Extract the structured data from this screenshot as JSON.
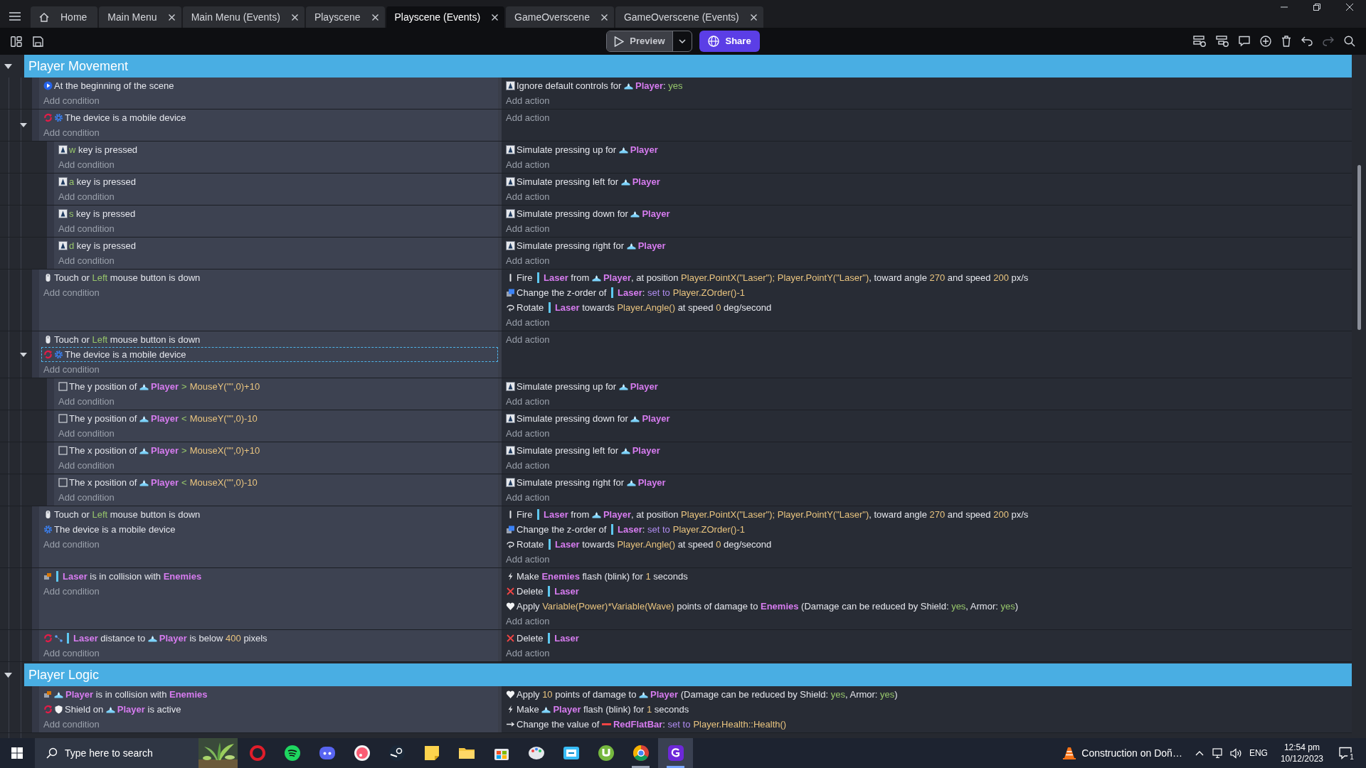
{
  "tabs": [
    {
      "label": "Home",
      "kind": "home",
      "selected": false
    },
    {
      "label": "Main Menu",
      "kind": "editor",
      "selected": false
    },
    {
      "label": "Main Menu (Events)",
      "kind": "editor",
      "selected": false
    },
    {
      "label": "Playscene",
      "kind": "editor",
      "selected": false
    },
    {
      "label": "Playscene (Events)",
      "kind": "editor",
      "selected": true
    },
    {
      "label": "GameOverscene",
      "kind": "editor",
      "selected": false
    },
    {
      "label": "GameOverscene (Events)",
      "kind": "editor",
      "selected": false
    }
  ],
  "toolbar": {
    "preview_label": "Preview",
    "share_label": "Share",
    "redo_disabled": true
  },
  "groups": [
    {
      "title": "Player Movement",
      "expanded": true,
      "events": [
        {
          "conditions": [
            {
              "kind": "scene_start",
              "inverted": false,
              "selected": false,
              "parts": [
                {
                  "text": "At the beginning of the scene"
                }
              ]
            }
          ],
          "add_condition": "Add condition",
          "actions": [
            {
              "kind": "keyboard",
              "parts": [
                {
                  "text": "Ignore default controls for "
                },
                {
                  "object": "Player",
                  "kind": "sprite"
                },
                {
                  "text": ": "
                },
                {
                  "keyword": "yes"
                }
              ]
            }
          ],
          "add_action": "Add action"
        },
        {
          "conditions": [
            {
              "kind": "mobile",
              "inverted": true,
              "selected": false,
              "parts": [
                {
                  "text": "The device is a mobile device"
                }
              ]
            }
          ],
          "add_condition": "Add condition",
          "add_action": "Add action",
          "expanded": true,
          "children": [
            {
              "conditions": [
                {
                  "kind": "key",
                  "inverted": false,
                  "selected": false,
                  "parts": [
                    {
                      "keyword": "w"
                    },
                    {
                      "text": " key is pressed"
                    }
                  ]
                }
              ],
              "add_condition": "Add condition",
              "actions": [
                {
                  "kind": "keyboard",
                  "parts": [
                    {
                      "text": "Simulate pressing up for "
                    },
                    {
                      "object": "Player",
                      "kind": "sprite"
                    }
                  ]
                }
              ],
              "add_action": "Add action"
            },
            {
              "conditions": [
                {
                  "kind": "key",
                  "inverted": false,
                  "selected": false,
                  "parts": [
                    {
                      "keyword": "a"
                    },
                    {
                      "text": " key is pressed"
                    }
                  ]
                }
              ],
              "add_condition": "Add condition",
              "actions": [
                {
                  "kind": "keyboard",
                  "parts": [
                    {
                      "text": "Simulate pressing left for "
                    },
                    {
                      "object": "Player",
                      "kind": "sprite"
                    }
                  ]
                }
              ],
              "add_action": "Add action"
            },
            {
              "conditions": [
                {
                  "kind": "key",
                  "inverted": false,
                  "selected": false,
                  "parts": [
                    {
                      "keyword": "s"
                    },
                    {
                      "text": " key is pressed"
                    }
                  ]
                }
              ],
              "add_condition": "Add condition",
              "actions": [
                {
                  "kind": "keyboard",
                  "parts": [
                    {
                      "text": "Simulate pressing down for "
                    },
                    {
                      "object": "Player",
                      "kind": "sprite"
                    }
                  ]
                }
              ],
              "add_action": "Add action"
            },
            {
              "conditions": [
                {
                  "kind": "key",
                  "inverted": false,
                  "selected": false,
                  "parts": [
                    {
                      "keyword": "d"
                    },
                    {
                      "text": " key is pressed"
                    }
                  ]
                }
              ],
              "add_condition": "Add condition",
              "actions": [
                {
                  "kind": "keyboard",
                  "parts": [
                    {
                      "text": "Simulate pressing right for "
                    },
                    {
                      "object": "Player",
                      "kind": "sprite"
                    }
                  ]
                }
              ],
              "add_action": "Add action"
            }
          ]
        },
        {
          "conditions": [
            {
              "kind": "mouse",
              "inverted": false,
              "selected": false,
              "parts": [
                {
                  "text": "Touch or "
                },
                {
                  "keyword": "Left"
                },
                {
                  "text": " mouse button is down"
                }
              ]
            }
          ],
          "add_condition": "Add condition",
          "actions": [
            {
              "kind": "fire",
              "parts": [
                {
                  "text": "Fire "
                },
                {
                  "object": "Laser",
                  "kind": "bullet"
                },
                {
                  "text": " from "
                },
                {
                  "object": "Player",
                  "kind": "sprite"
                },
                {
                  "text": ", at position "
                },
                {
                  "value": "Player.PointX(\"Laser\"); Player.PointY(\"Laser\")"
                },
                {
                  "text": ", toward angle "
                },
                {
                  "value": "270"
                },
                {
                  "text": " and speed "
                },
                {
                  "value": "200"
                },
                {
                  "text": " px/s"
                }
              ]
            },
            {
              "kind": "zorder",
              "parts": [
                {
                  "text": "Change the z-order of "
                },
                {
                  "object": "Laser",
                  "kind": "bullet"
                },
                {
                  "text": ": "
                },
                {
                  "setter": "set to"
                },
                {
                  "value": "Player.ZOrder()-1"
                }
              ]
            },
            {
              "kind": "rotate",
              "parts": [
                {
                  "text": "Rotate "
                },
                {
                  "object": "Laser",
                  "kind": "bullet"
                },
                {
                  "text": " towards "
                },
                {
                  "value": "Player.Angle()"
                },
                {
                  "text": " at speed "
                },
                {
                  "value": "0"
                },
                {
                  "text": " deg/second"
                }
              ]
            }
          ],
          "add_action": "Add action"
        },
        {
          "conditions": [
            {
              "kind": "mouse",
              "inverted": false,
              "selected": false,
              "parts": [
                {
                  "text": "Touch or "
                },
                {
                  "keyword": "Left"
                },
                {
                  "text": " mouse button is down"
                }
              ]
            },
            {
              "kind": "mobile",
              "inverted": true,
              "selected": true,
              "parts": [
                {
                  "text": "The device is a mobile device"
                }
              ]
            }
          ],
          "add_condition": "Add condition",
          "add_action": "Add action",
          "expanded": true,
          "children": [
            {
              "conditions": [
                {
                  "kind": "position",
                  "inverted": false,
                  "selected": false,
                  "parts": [
                    {
                      "text": "The y position of "
                    },
                    {
                      "object": "Player",
                      "kind": "sprite"
                    },
                    {
                      "operator": ">"
                    },
                    {
                      "value": "MouseY(\"\",0)+10"
                    }
                  ]
                }
              ],
              "add_condition": "Add condition",
              "actions": [
                {
                  "kind": "keyboard",
                  "parts": [
                    {
                      "text": "Simulate pressing up for "
                    },
                    {
                      "object": "Player",
                      "kind": "sprite"
                    }
                  ]
                }
              ],
              "add_action": "Add action"
            },
            {
              "conditions": [
                {
                  "kind": "position",
                  "inverted": false,
                  "selected": false,
                  "parts": [
                    {
                      "text": "The y position of "
                    },
                    {
                      "object": "Player",
                      "kind": "sprite"
                    },
                    {
                      "operator": "<"
                    },
                    {
                      "value": "MouseY(\"\",0)-10"
                    }
                  ]
                }
              ],
              "add_condition": "Add condition",
              "actions": [
                {
                  "kind": "keyboard",
                  "parts": [
                    {
                      "text": "Simulate pressing down for "
                    },
                    {
                      "object": "Player",
                      "kind": "sprite"
                    }
                  ]
                }
              ],
              "add_action": "Add action"
            },
            {
              "conditions": [
                {
                  "kind": "position",
                  "inverted": false,
                  "selected": false,
                  "parts": [
                    {
                      "text": "The x position of "
                    },
                    {
                      "object": "Player",
                      "kind": "sprite"
                    },
                    {
                      "operator": ">"
                    },
                    {
                      "value": "MouseX(\"\",0)+10"
                    }
                  ]
                }
              ],
              "add_condition": "Add condition",
              "actions": [
                {
                  "kind": "keyboard",
                  "parts": [
                    {
                      "text": "Simulate pressing left for "
                    },
                    {
                      "object": "Player",
                      "kind": "sprite"
                    }
                  ]
                }
              ],
              "add_action": "Add action"
            },
            {
              "conditions": [
                {
                  "kind": "position",
                  "inverted": false,
                  "selected": false,
                  "parts": [
                    {
                      "text": "The x position of "
                    },
                    {
                      "object": "Player",
                      "kind": "sprite"
                    },
                    {
                      "operator": "<"
                    },
                    {
                      "value": "MouseX(\"\",0)-10"
                    }
                  ]
                }
              ],
              "add_condition": "Add condition",
              "actions": [
                {
                  "kind": "keyboard",
                  "parts": [
                    {
                      "text": "Simulate pressing right for "
                    },
                    {
                      "object": "Player",
                      "kind": "sprite"
                    }
                  ]
                }
              ],
              "add_action": "Add action"
            }
          ]
        },
        {
          "conditions": [
            {
              "kind": "mouse",
              "inverted": false,
              "selected": false,
              "parts": [
                {
                  "text": "Touch or "
                },
                {
                  "keyword": "Left"
                },
                {
                  "text": " mouse button is down"
                }
              ]
            },
            {
              "kind": "mobile",
              "inverted": false,
              "selected": false,
              "parts": [
                {
                  "text": "The device is a mobile device"
                }
              ]
            }
          ],
          "add_condition": "Add condition",
          "actions": [
            {
              "kind": "fire",
              "parts": [
                {
                  "text": "Fire "
                },
                {
                  "object": "Laser",
                  "kind": "bullet"
                },
                {
                  "text": " from "
                },
                {
                  "object": "Player",
                  "kind": "sprite"
                },
                {
                  "text": ", at position "
                },
                {
                  "value": "Player.PointX(\"Laser\"); Player.PointY(\"Laser\")"
                },
                {
                  "text": ", toward angle "
                },
                {
                  "value": "270"
                },
                {
                  "text": " and speed "
                },
                {
                  "value": "200"
                },
                {
                  "text": " px/s"
                }
              ]
            },
            {
              "kind": "zorder",
              "parts": [
                {
                  "text": "Change the z-order of "
                },
                {
                  "object": "Laser",
                  "kind": "bullet"
                },
                {
                  "text": ": "
                },
                {
                  "setter": "set to"
                },
                {
                  "value": "Player.ZOrder()-1"
                }
              ]
            },
            {
              "kind": "rotate",
              "parts": [
                {
                  "text": "Rotate "
                },
                {
                  "object": "Laser",
                  "kind": "bullet"
                },
                {
                  "text": " towards "
                },
                {
                  "value": "Player.Angle()"
                },
                {
                  "text": " at speed "
                },
                {
                  "value": "0"
                },
                {
                  "text": " deg/second"
                }
              ]
            }
          ],
          "add_action": "Add action"
        },
        {
          "conditions": [
            {
              "kind": "collision",
              "inverted": false,
              "selected": false,
              "parts": [
                {
                  "object": "Laser",
                  "kind": "bullet"
                },
                {
                  "text": " is in collision with "
                },
                {
                  "object": "Enemies"
                }
              ]
            }
          ],
          "add_condition": "Add condition",
          "actions": [
            {
              "kind": "flash",
              "parts": [
                {
                  "text": "Make "
                },
                {
                  "object": "Enemies"
                },
                {
                  "text": " flash (blink) for "
                },
                {
                  "value": "1"
                },
                {
                  "text": " seconds"
                }
              ]
            },
            {
              "kind": "delete",
              "parts": [
                {
                  "text": "Delete "
                },
                {
                  "object": "Laser",
                  "kind": "bullet"
                }
              ]
            },
            {
              "kind": "damage",
              "parts": [
                {
                  "text": "Apply "
                },
                {
                  "value": "Variable(Power)*Variable(Wave)"
                },
                {
                  "text": " points of damage to "
                },
                {
                  "object": "Enemies"
                },
                {
                  "text": " (Damage can be reduced by Shield: "
                },
                {
                  "keyword": "yes"
                },
                {
                  "text": ", Armor: "
                },
                {
                  "keyword": "yes"
                },
                {
                  "text": ")"
                }
              ]
            }
          ],
          "add_action": "Add action"
        },
        {
          "conditions": [
            {
              "kind": "distance",
              "inverted": true,
              "selected": false,
              "parts": [
                {
                  "object": "Laser",
                  "kind": "bullet"
                },
                {
                  "text": " distance to "
                },
                {
                  "object": "Player",
                  "kind": "sprite"
                },
                {
                  "text": " is below "
                },
                {
                  "value": "400"
                },
                {
                  "text": " pixels"
                }
              ]
            }
          ],
          "add_condition": "Add condition",
          "actions": [
            {
              "kind": "delete",
              "parts": [
                {
                  "text": "Delete "
                },
                {
                  "object": "Laser",
                  "kind": "bullet"
                }
              ]
            }
          ],
          "add_action": "Add action"
        }
      ]
    },
    {
      "title": "Player Logic",
      "expanded": true,
      "events": [
        {
          "conditions": [
            {
              "kind": "collision",
              "inverted": false,
              "selected": false,
              "parts": [
                {
                  "object": "Player",
                  "kind": "sprite"
                },
                {
                  "text": " is in collision with "
                },
                {
                  "object": "Enemies"
                }
              ]
            },
            {
              "kind": "shield",
              "inverted": true,
              "selected": false,
              "parts": [
                {
                  "text": "Shield on "
                },
                {
                  "object": "Player",
                  "kind": "sprite"
                },
                {
                  "text": " is active"
                }
              ]
            }
          ],
          "add_condition": "Add condition",
          "actions": [
            {
              "kind": "damage",
              "parts": [
                {
                  "text": "Apply "
                },
                {
                  "value": "10"
                },
                {
                  "text": " points of damage to "
                },
                {
                  "object": "Player",
                  "kind": "sprite"
                },
                {
                  "text": " (Damage can be reduced by Shield: "
                },
                {
                  "keyword": "yes"
                },
                {
                  "text": ", Armor: "
                },
                {
                  "keyword": "yes"
                },
                {
                  "text": ")"
                }
              ]
            },
            {
              "kind": "flash",
              "parts": [
                {
                  "text": "Make "
                },
                {
                  "object": "Player",
                  "kind": "sprite"
                },
                {
                  "text": " flash (blink) for "
                },
                {
                  "value": "1"
                },
                {
                  "text": " seconds"
                }
              ]
            },
            {
              "kind": "variable",
              "parts": [
                {
                  "text": "Change the value of "
                },
                {
                  "object": "RedFlatBar",
                  "kind": "bar"
                },
                {
                  "text": ": "
                },
                {
                  "setter": "set to"
                },
                {
                  "value": "Player.Health::Health()"
                }
              ]
            }
          ]
        }
      ]
    }
  ],
  "taskbar": {
    "search_placeholder": "Type here to search",
    "apps": [
      {
        "running": false,
        "selected": false
      },
      {
        "running": false,
        "selected": false
      },
      {
        "running": false,
        "selected": false
      },
      {
        "running": false,
        "selected": false
      },
      {
        "running": false,
        "selected": false
      },
      {
        "running": false,
        "selected": false
      },
      {
        "running": false,
        "selected": false
      },
      {
        "running": false,
        "selected": false
      },
      {
        "running": false,
        "selected": false
      },
      {
        "running": false,
        "selected": false
      },
      {
        "running": false,
        "selected": false
      },
      {
        "running": true,
        "selected": false
      },
      {
        "running": true,
        "selected": true
      }
    ],
    "weather_text": "Construction on Doñ…",
    "language": "ENG",
    "time": "12:54 pm",
    "date": "10/12/2023",
    "notification_count": "1"
  }
}
